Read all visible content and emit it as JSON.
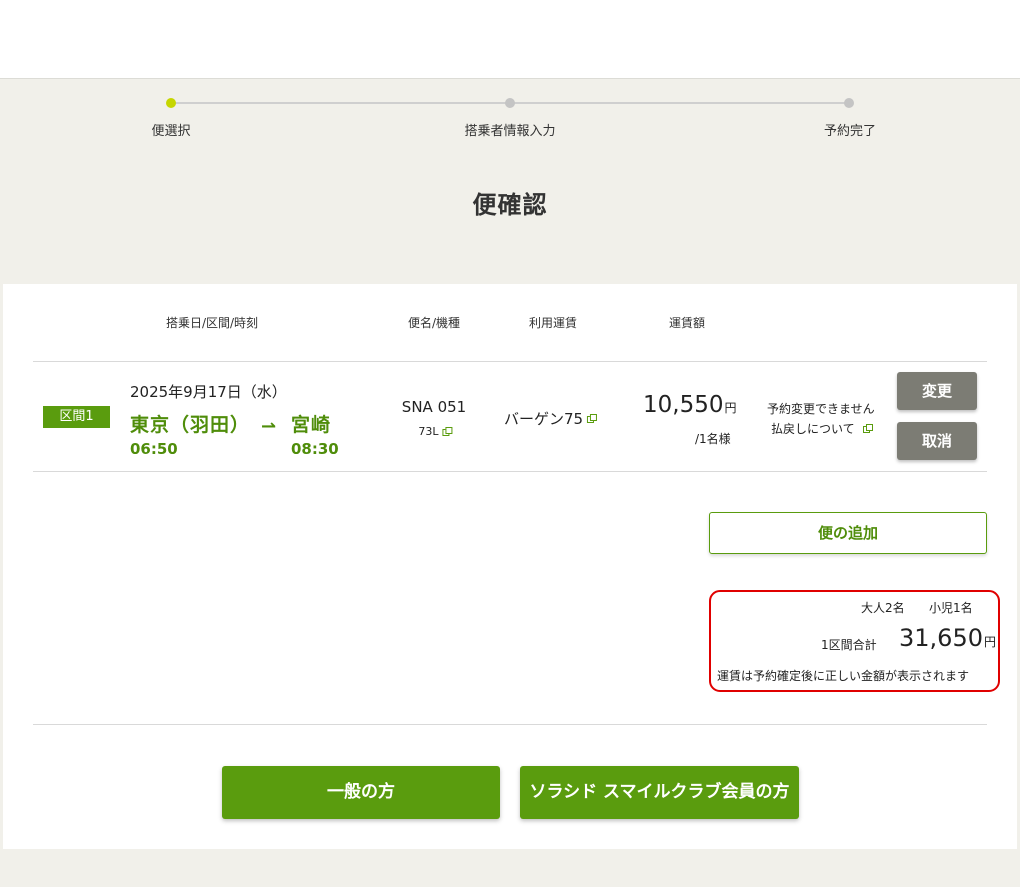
{
  "stepper": {
    "steps": [
      {
        "label": "便選択",
        "active": true
      },
      {
        "label": "搭乗者情報入力",
        "active": false
      },
      {
        "label": "予約完了",
        "active": false
      }
    ]
  },
  "page": {
    "title": "便確認"
  },
  "table": {
    "headers": {
      "date_route_time": "搭乗日/区間/時刻",
      "flight_aircraft": "便名/機種",
      "fare_type": "利用運賃",
      "fare_amount": "運賃額"
    }
  },
  "segment": {
    "badge": "区間1",
    "date": "2025年9月17日（水）",
    "departure_city": "東京（羽田）",
    "arrival_city": "宮崎",
    "departure_time": "06:50",
    "arrival_time": "08:30",
    "flight_number": "SNA 051",
    "aircraft": "73L",
    "fare_type": "バーゲン75",
    "fare_amount": "10,550",
    "currency": "円",
    "per_person": "/1名様",
    "change_note": "予約変更できません",
    "refund_note": "払戻しについて",
    "change_button": "変更",
    "cancel_button": "取消"
  },
  "actions": {
    "add_flight": "便の追加",
    "general_button": "一般の方",
    "member_button": "ソラシド スマイルクラブ会員の方"
  },
  "summary": {
    "adults": "大人2名",
    "children": "小児1名",
    "total_label": "1区間合計",
    "total_amount": "31,650",
    "currency": "円",
    "note": "運賃は予約確定後に正しい金額が表示されます"
  },
  "colors": {
    "brand_green": "#5a9c0e",
    "active_step": "#c6d600",
    "highlight_border": "#e00000",
    "gray_button": "#7c7c74"
  }
}
